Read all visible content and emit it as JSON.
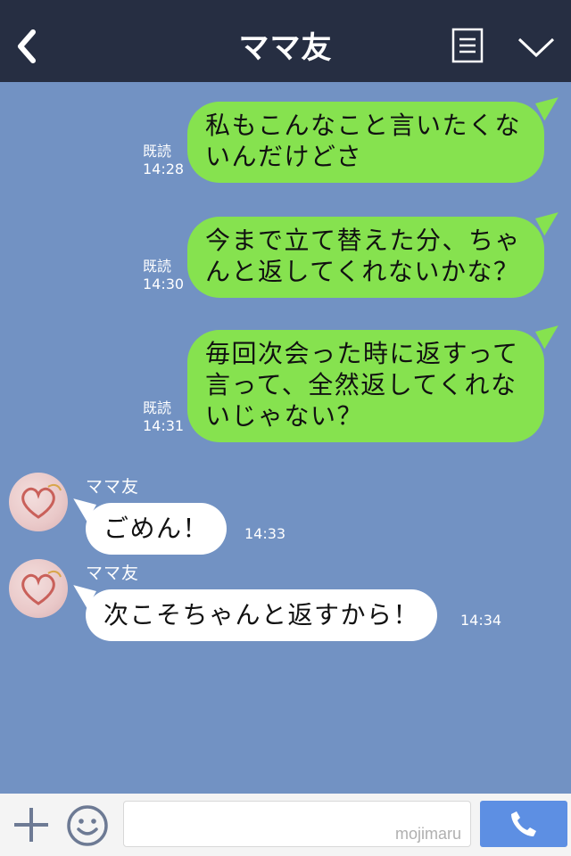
{
  "header": {
    "title": "ママ友",
    "back_icon": "chevron-left-icon",
    "menu_icon": "list-icon",
    "collapse_icon": "chevron-down-icon"
  },
  "messages_out": [
    {
      "text": "私もこんなこと言いたくないんだけどさ",
      "read": "既読",
      "time": "14:28"
    },
    {
      "text": "今まで立て替えた分、ちゃんと返してくれないかな？",
      "read": "既読",
      "time": "14:30"
    },
    {
      "text": "毎回次会った時に返すって言って、全然返してくれないじゃない？",
      "read": "既読",
      "time": "14:31"
    }
  ],
  "messages_in": [
    {
      "sender": "ママ友",
      "text": "ごめん！",
      "time": "14:33"
    },
    {
      "sender": "ママ友",
      "text": "次こそちゃんと返すから！",
      "time": "14:34"
    }
  ],
  "input_bar": {
    "plus_icon": "plus-icon",
    "emoji_icon": "smiley-icon",
    "watermark": "mojimaru",
    "call_icon": "phone-icon"
  },
  "colors": {
    "header_bg": "#262e42",
    "chat_bg": "#7292c3",
    "outgoing_bubble": "#86e24f",
    "incoming_bubble": "#ffffff",
    "call_button": "#5d8fe3"
  }
}
